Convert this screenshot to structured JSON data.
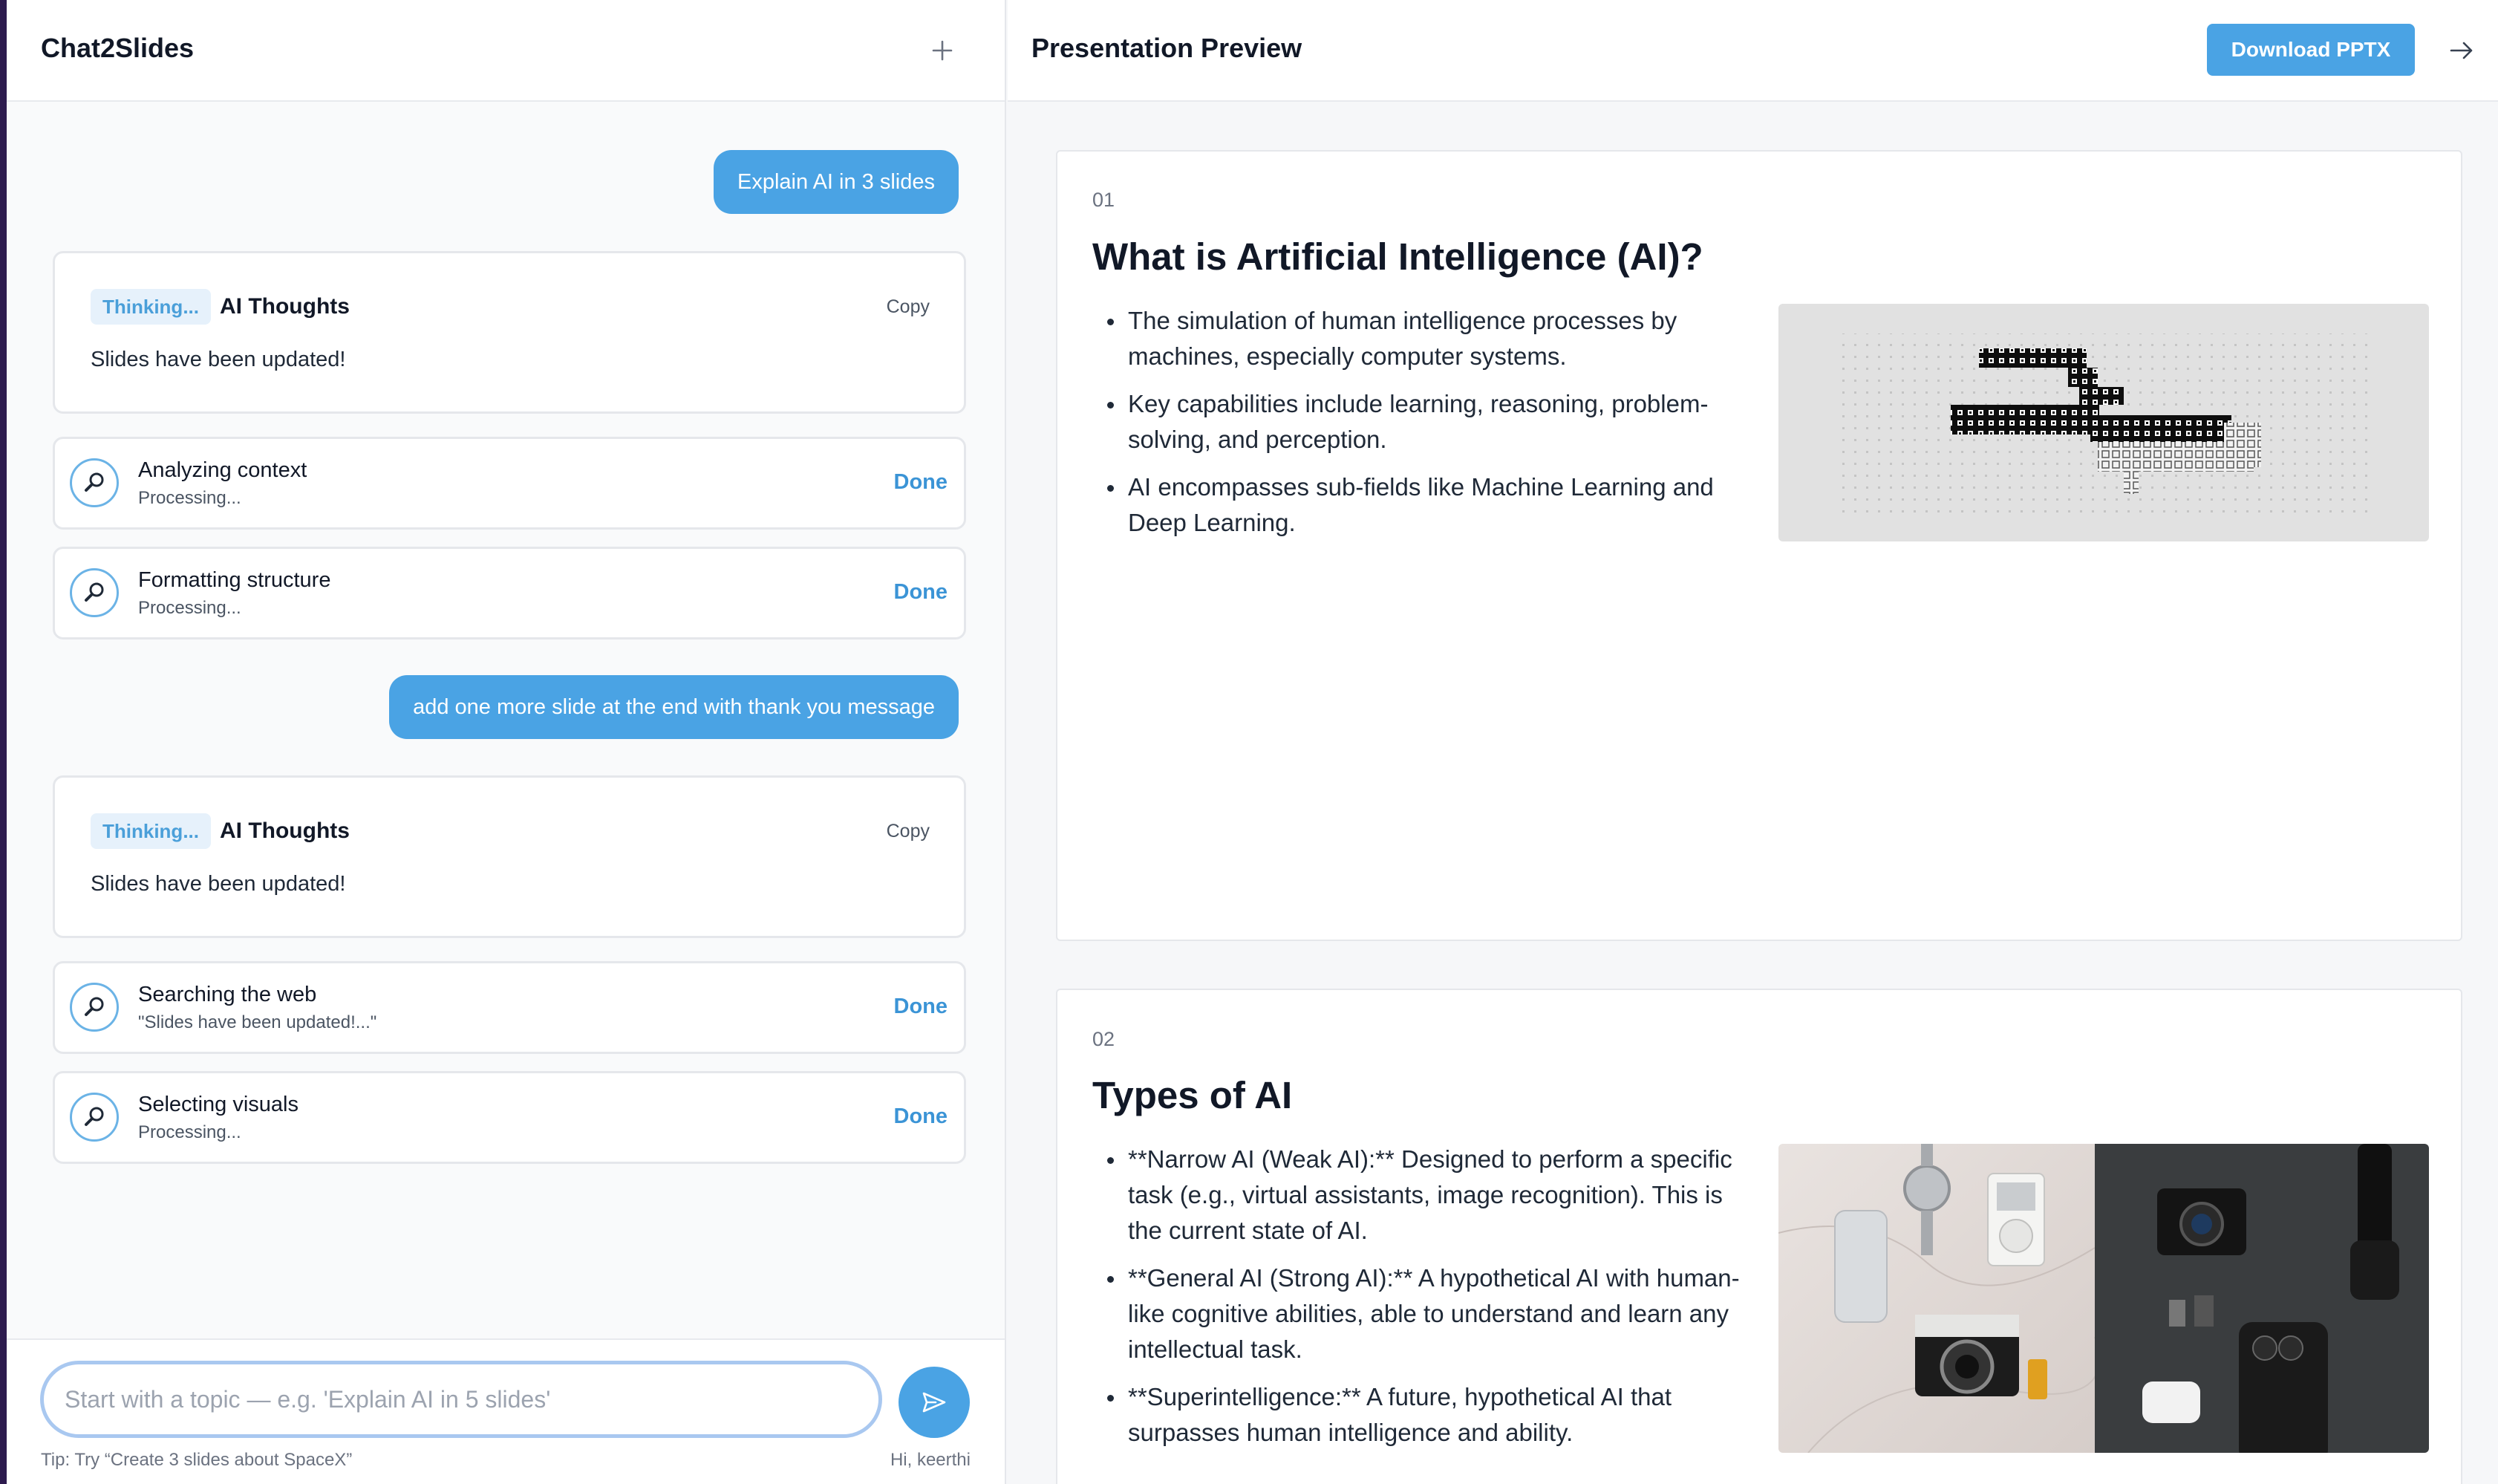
{
  "left": {
    "title": "Chat2Slides",
    "new_chat_icon": "plus-icon"
  },
  "chat": [
    {
      "type": "user",
      "text": "Explain AI in 3 slides"
    },
    {
      "type": "thought",
      "badge": "Thinking...",
      "title": "AI Thoughts",
      "copy": "Copy",
      "text": "Slides have been updated!"
    },
    {
      "type": "step",
      "name": "Analyzing context",
      "sub": "Processing...",
      "status": "Done",
      "icon": "search-icon"
    },
    {
      "type": "step",
      "name": "Formatting structure",
      "sub": "Processing...",
      "status": "Done",
      "icon": "search-icon"
    },
    {
      "type": "user",
      "text": "add one more slide at the end with thank you message"
    },
    {
      "type": "thought",
      "badge": "Thinking...",
      "title": "AI Thoughts",
      "copy": "Copy",
      "text": "Slides have been updated!"
    },
    {
      "type": "step",
      "name": "Searching the web",
      "sub": "\"Slides have been updated!...\"",
      "status": "Done",
      "icon": "search-icon"
    },
    {
      "type": "step",
      "name": "Selecting visuals",
      "sub": "Processing...",
      "status": "Done",
      "icon": "search-icon"
    }
  ],
  "composer": {
    "placeholder": "Start with a topic — e.g. 'Explain AI in 5 slides'",
    "value": "",
    "send_icon": "send-icon",
    "tip": "Tip: Try “Create 3 slides about SpaceX”",
    "greeting": "Hi, keerthi"
  },
  "preview": {
    "title": "Presentation Preview",
    "download": "Download PPTX",
    "collapse_icon": "arrow-right-icon",
    "slides": [
      {
        "number": "01",
        "title": "What is Artificial Intelligence (AI)?",
        "bullets": [
          "The simulation of human intelligence processes by machines, especially computer systems.",
          "Key capabilities include learning, reasoning, problem-solving, and perception.",
          "AI encompasses sub-fields like Machine Learning and Deep Learning."
        ],
        "image": "pixel-art-illustration"
      },
      {
        "number": "02",
        "title": "Types of AI",
        "bullets": [
          "**Narrow AI (Weak AI):** Designed to perform a specific task (e.g., virtual assistants, image recognition). This is the current state of AI.",
          "**General AI (Strong AI):** A hypothetical AI with human-like cognitive abilities, able to understand and learn any intellectual task.",
          "**Superintelligence:** A future, hypothetical AI that surpasses human intelligence and ability."
        ],
        "image": "gadgets-photo"
      }
    ]
  },
  "colors": {
    "accent": "#4aa3e4",
    "done": "#3b94d6",
    "badge_bg": "#e6f1fb",
    "sidebar_edge": "#2d1b4e"
  }
}
